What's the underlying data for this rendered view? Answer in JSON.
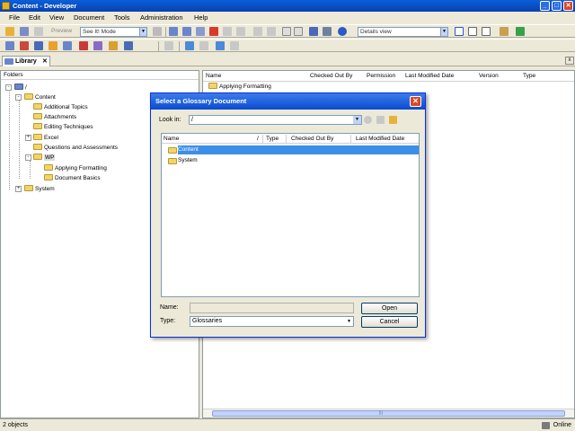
{
  "window": {
    "title": "Content - Developer",
    "controls": {
      "minimize": "_",
      "maximize": "□",
      "close": "✕"
    }
  },
  "menu": [
    "File",
    "Edit",
    "View",
    "Document",
    "Tools",
    "Administration",
    "Help"
  ],
  "toolbar1": {
    "preview_label": "Preview",
    "mode_combo": "See It! Mode",
    "view_combo": "Details view"
  },
  "tab": {
    "label": "Library",
    "close": "✕",
    "close_all": "x"
  },
  "folders": {
    "header": "Folders",
    "root": "/",
    "items": [
      {
        "label": "Content",
        "level": 1,
        "expander": "-"
      },
      {
        "label": "Additional Topics",
        "level": 2
      },
      {
        "label": "Attachments",
        "level": 2
      },
      {
        "label": "Editing Techniques",
        "level": 2
      },
      {
        "label": "Excel",
        "level": 2,
        "expander": "+"
      },
      {
        "label": "Questions and Assessments",
        "level": 2
      },
      {
        "label": "WP",
        "level": 2,
        "expander": "-",
        "selected": true
      },
      {
        "label": "Applying Formatting",
        "level": 3
      },
      {
        "label": "Document Basics",
        "level": 3
      },
      {
        "label": "System",
        "level": 1,
        "expander": "+"
      }
    ]
  },
  "documents": {
    "columns": [
      "Name",
      "Checked Out By",
      "Permission",
      "Last Modified Date",
      "Version",
      "Type"
    ],
    "rows": [
      {
        "name": "Applying Formatting"
      }
    ],
    "scroll_grip": "|||"
  },
  "status": {
    "text": "2 objects",
    "connection": "Online"
  },
  "dialog": {
    "title": "Select a Glossary Document",
    "close": "✕",
    "lookin_label": "Look in:",
    "lookin_value": "/",
    "columns": [
      "Name",
      "/",
      "Type",
      "Checked Out By",
      "Last Modified Date"
    ],
    "files": [
      {
        "name": "Content",
        "selected": true
      },
      {
        "name": "System",
        "selected": false
      }
    ],
    "name_label": "Name:",
    "name_value": "",
    "type_label": "Type:",
    "type_value": "Glossaries",
    "open_button": "Open",
    "cancel_button": "Cancel"
  },
  "combo_arrow": "▼",
  "colors": {
    "titlebar": "#0a5fd8",
    "selection": "#3d8ee8",
    "window_bg": "#ece9d8"
  }
}
